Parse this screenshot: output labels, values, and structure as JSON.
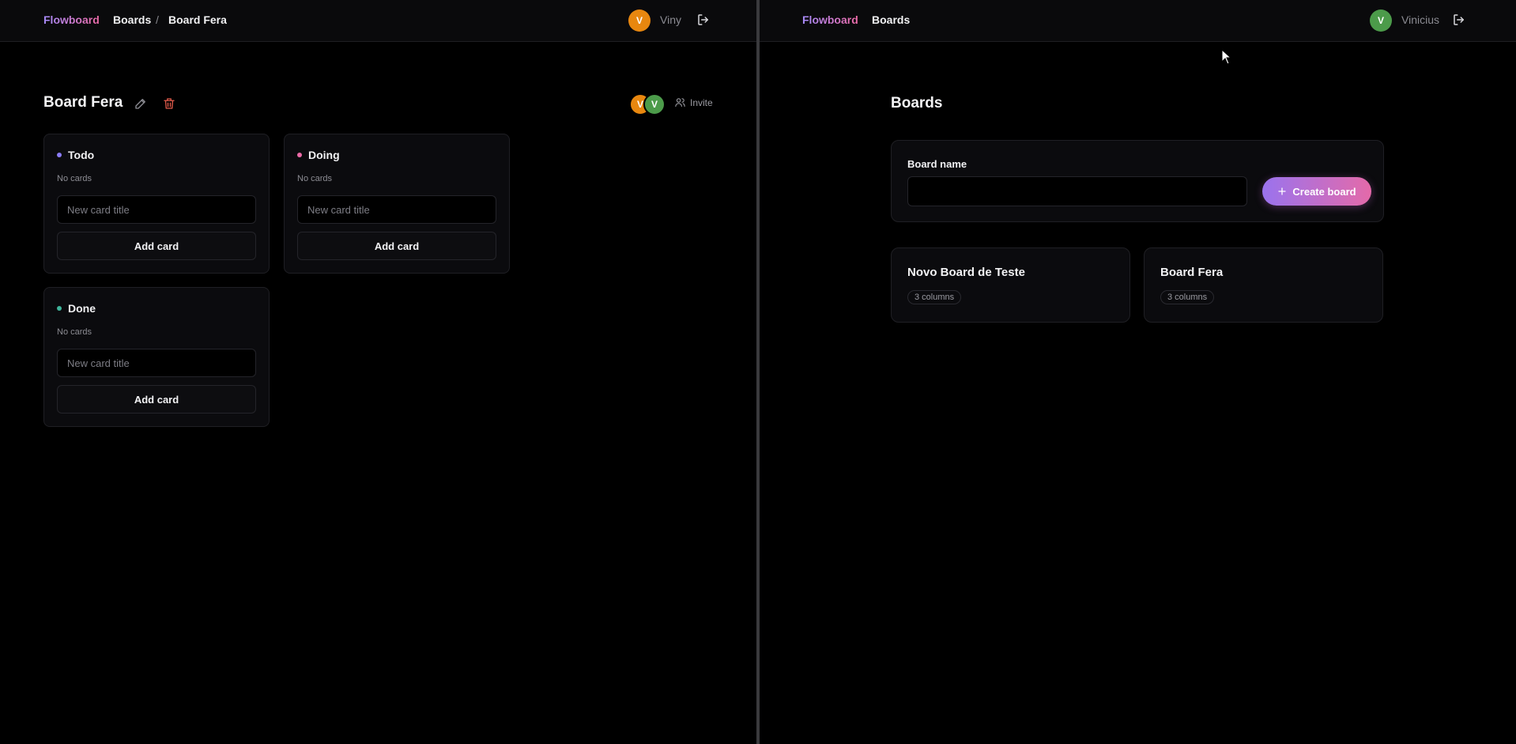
{
  "left": {
    "brand": "Flowboard",
    "breadcrumb": {
      "boards": "Boards",
      "separator": "/",
      "current": "Board Fera"
    },
    "user": {
      "initial": "V",
      "name": "Viny",
      "avatar_color": "#e8870f"
    },
    "board": {
      "title": "Board Fera",
      "members": [
        {
          "initial": "V",
          "color": "#e8870f"
        },
        {
          "initial": "V",
          "color": "#4c9b4a"
        }
      ],
      "invite_label": "Invite",
      "columns": [
        {
          "name": "Todo",
          "dot_color": "#8b7cf6",
          "empty_text": "No cards",
          "input_placeholder": "New card title",
          "add_label": "Add card"
        },
        {
          "name": "Doing",
          "dot_color": "#ec6aa7",
          "empty_text": "No cards",
          "input_placeholder": "New card title",
          "add_label": "Add card"
        },
        {
          "name": "Done",
          "dot_color": "#3fb59b",
          "empty_text": "No cards",
          "input_placeholder": "New card title",
          "add_label": "Add card"
        }
      ]
    }
  },
  "right": {
    "brand": "Flowboard",
    "nav_boards": "Boards",
    "user": {
      "initial": "V",
      "name": "Vinicius",
      "avatar_color": "#4c9b4a"
    },
    "heading": "Boards",
    "create": {
      "field_label": "Board name",
      "input_value": "",
      "button_label": "Create board",
      "button_icon": "plus-icon"
    },
    "boards": [
      {
        "title": "Novo Board de Teste",
        "badge": "3 columns"
      },
      {
        "title": "Board Fera",
        "badge": "3 columns"
      }
    ]
  },
  "colors": {
    "accent_start": "#9a73ee",
    "accent_end": "#e46aa9",
    "delete_icon": "#e05a4a"
  }
}
